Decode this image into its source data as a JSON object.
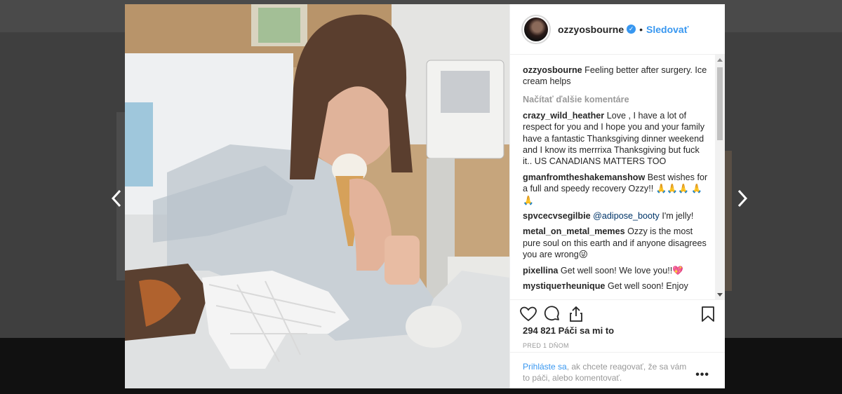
{
  "post": {
    "username": "ozzyosbourne",
    "follow_label": "Sledovať",
    "separator": "•",
    "verified_glyph": "✓",
    "likes": "294 821 Páči sa mi to",
    "timestamp": "PRED 1 DŇOM"
  },
  "caption": {
    "user": "ozzyosbourne",
    "text": "Feeling better after surgery. Ice cream helps"
  },
  "load_more_label": "Načítať ďalšie komentáre",
  "comments": [
    {
      "user": "crazy_wild_heather",
      "text": "Love , I have a lot of respect for you and I hope you and your family have a fantastic Thanksgiving dinner weekend and I know its merrrixa Thanksgiving but fuck it.. US CANADIANS MATTERS TOO"
    },
    {
      "user": "gmanfromtheshakemanshow",
      "text": "Best wishes for a full and speedy recovery Ozzy!! 🙏🙏🙏 🙏🙏"
    },
    {
      "user": "spvcecvsegilbie",
      "mention": "@adipose_booty",
      "text": "I'm jelly!"
    },
    {
      "user": "metal_on_metal_memes",
      "text": "Ozzy is the most pure soul on this earth and if anyone disagrees you are wrong😜"
    },
    {
      "user": "pixellina",
      "text": "Get well soon! We love you!!💖"
    },
    {
      "user": "mystiqueтheunique",
      "text": "Get well soon! Enjoy"
    }
  ],
  "login": {
    "link": "Prihláste sa",
    "text": ", ak chcete reagovať, že sa vám to páči, alebo komentovať."
  },
  "more_label": "•••",
  "icons": {
    "prev": "chevron-left-icon",
    "next": "chevron-right-icon",
    "like": "heart-icon",
    "comment": "comment-bubble-icon",
    "share": "share-icon",
    "save": "bookmark-icon"
  },
  "colors": {
    "accent": "#3897f0",
    "text": "#262626",
    "muted": "#999999"
  }
}
